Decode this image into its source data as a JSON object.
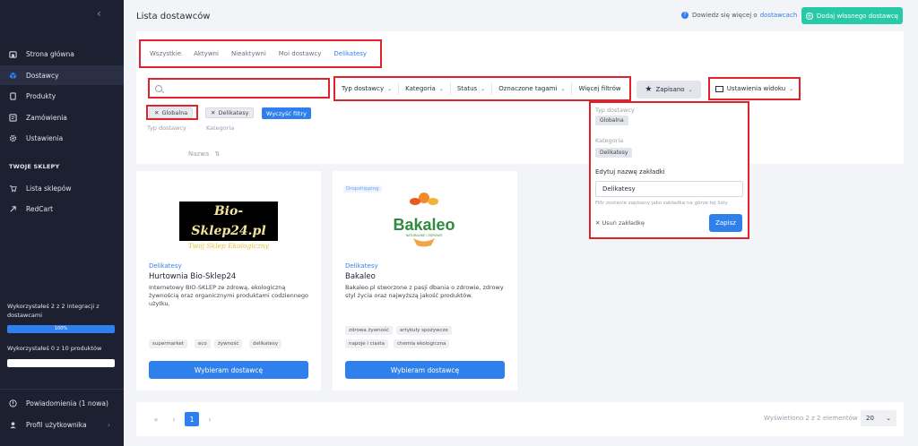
{
  "sidebar": {
    "nav": [
      {
        "label": "Strona główna",
        "icon": "home-icon"
      },
      {
        "label": "Dostawcy",
        "icon": "box-icon",
        "active": true
      },
      {
        "label": "Produkty",
        "icon": "document-icon"
      },
      {
        "label": "Zamówienia",
        "icon": "orders-icon"
      },
      {
        "label": "Ustawienia",
        "icon": "gear-icon"
      }
    ],
    "section_title": "TWOJE SKLEPY",
    "shops": [
      {
        "label": "Lista sklepów",
        "icon": "cart-icon"
      },
      {
        "label": "RedCart",
        "icon": "redcart-icon"
      }
    ],
    "usage_integrations": "Wykorzystałeś 2 z 2 integracji z dostawcami",
    "usage_integrations_pct": "100%",
    "usage_integrations_fraction": 1.0,
    "usage_products": "Wykorzystałeś 0 z 10 produktów",
    "usage_products_fraction": 0.0,
    "notifications": "Powiadomienia (1 nowa)",
    "profile": "Profil użytkownika"
  },
  "header": {
    "title": "Lista dostawców",
    "help_text": "Dowiedz się więcej o",
    "help_link": "dostawcach",
    "add_button": "Dodaj własnego dostawcę"
  },
  "tabs": [
    {
      "label": "Wszystkie",
      "active": false
    },
    {
      "label": "Aktywni",
      "active": false
    },
    {
      "label": "Nieaktywni",
      "active": false
    },
    {
      "label": "Moi dostawcy",
      "active": false
    },
    {
      "label": "Delikatesy",
      "active": true
    }
  ],
  "search": {
    "value": "",
    "placeholder": ""
  },
  "filters": {
    "dropdowns": [
      "Typ dostawcy",
      "Kategoria",
      "Status",
      "Oznaczone tagami",
      "Więcej filtrów"
    ],
    "saved": "Zapisano",
    "view_settings": "Ustawienia widoku",
    "chips": [
      {
        "label": "Globalna",
        "group": "Typ dostawcy"
      },
      {
        "label": "Delikatesy",
        "group": "Kategoria"
      }
    ],
    "clear": "Wyczyść filtry",
    "sort_label": "Nazwa"
  },
  "popup": {
    "type_label": "Typ dostawcy",
    "type_value": "Globalna",
    "category_label": "Kategoria",
    "category_value": "Delikatesy",
    "edit_label": "Edytuj nazwę zakładki",
    "input_value": "Delikatesy",
    "hint": "Filtr zostanie zapisany jako zakładka na górze tej listy",
    "delete": "Usuń zakładkę",
    "save": "Zapisz"
  },
  "cards": [
    {
      "badge": "",
      "logo_line1": "Bio-Sklep24.pl",
      "logo_line2": "Twój Sklep Ekologiczny",
      "category": "Delikatesy",
      "name": "Hurtownia Bio-Sklep24",
      "description": "Internetowy BIO-SKLEP ze zdrową, ekologiczną żywnością oraz organicznymi produktami codziennego użytku.",
      "tags": [
        "supermarket",
        "eco",
        "żywność",
        "delikatesy"
      ],
      "button": "Wybieram dostawcę"
    },
    {
      "badge": "Dropshipping",
      "logo_text": "Bakaleo",
      "logo_sub": "NATURALNIE I ZDROWO",
      "category": "Delikatesy",
      "name": "Bakaleo",
      "description": "Bakaleo.pl stworzone z pasji dbania o zdrowie, zdrowy styl życia oraz najwyższą jakość produktów.",
      "tags": [
        "zdrowa żywność",
        "artykuły spożywcze",
        "napoje i ciasta",
        "chemia ekologiczna"
      ],
      "button": "Wybieram dostawcę"
    }
  ],
  "pagination": {
    "first": "«",
    "prev": "‹",
    "current": "1",
    "next": "›",
    "showing": "Wyświetlono 2 z 2 elementów",
    "per_page": "20"
  },
  "colors": {
    "accent": "#2f80ed",
    "add": "#28c9a9",
    "sidebar": "#1d2030",
    "highlight": "#e0222a"
  }
}
